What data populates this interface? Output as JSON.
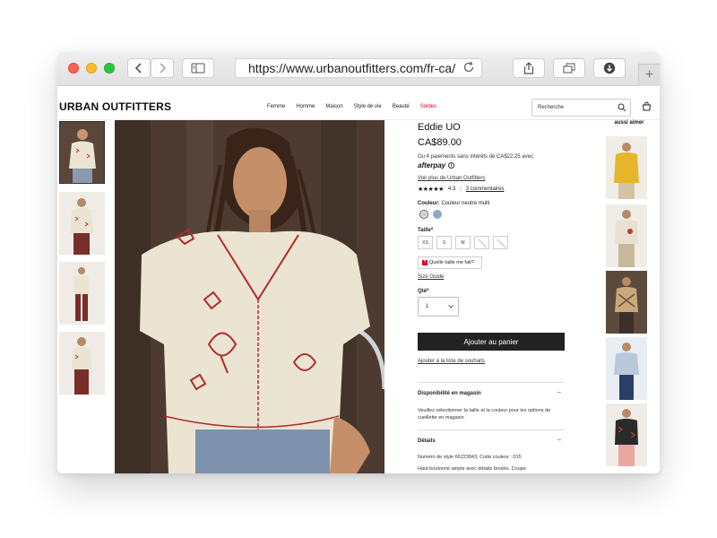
{
  "browser": {
    "url": "https://www.urbanoutfitters.com/fr-ca/"
  },
  "site": {
    "logo": "URBAN OUTFITTERS",
    "nav": [
      "Femme",
      "Homme",
      "Maison",
      "Style de vie",
      "Beauté",
      "Soldes"
    ],
    "search_placeholder": "Recherche",
    "also_like": "aussi aimer"
  },
  "product": {
    "title": "Eddie UO",
    "price": "CA$89.00",
    "installments": "Ou 4 paiements sans intérêts de CA$22.25 avec",
    "afterpay": "afterpay",
    "more_from_brand": "Voir plus de Urban Outfitters",
    "rating": "4.3",
    "reviews": "3 commentaires",
    "color_label": "Couleur:",
    "color_value": "Couleur neutre multi",
    "size_label": "Taille*",
    "sizes": [
      {
        "label": "XS",
        "available": true
      },
      {
        "label": "S",
        "available": true
      },
      {
        "label": "M",
        "available": true
      },
      {
        "label": "",
        "available": false
      },
      {
        "label": "",
        "available": false
      }
    ],
    "fit_button": "Quelle taille me fait?",
    "size_guide": "Size Guide",
    "qty_label": "Qté*",
    "qty_value": "1",
    "add_to_cart": "Ajouter au panier",
    "wishlist": "Ajouter à la liste de souhaits",
    "availability_title": "Disponibilité en magasin",
    "availability_text": "Veuillez sélectionner la taille et la couleur pour les options de cueillette en magasin",
    "details_title": "Détails",
    "details_style": "Numéro de style 66223843; Code couleur : 015",
    "details_desc": "Haut boutonné ample avec détails brodés. Coupe"
  },
  "colors": {
    "sale": "#d0021b",
    "cart_button": "#222222"
  }
}
